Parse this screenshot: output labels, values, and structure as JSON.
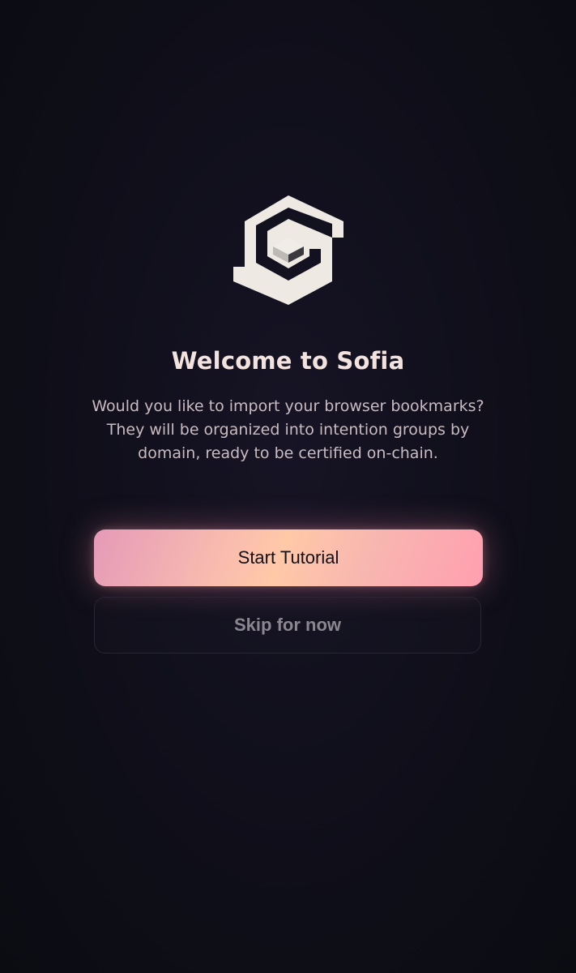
{
  "logo": {
    "icon": "sofia-hexagon-logo-icon"
  },
  "welcome": {
    "title": "Welcome to Sofia",
    "description": "Would you like to import your browser bookmarks? They will be organized into intention groups by domain, ready to be certified on-chain."
  },
  "actions": {
    "primary_label": "Start Tutorial",
    "secondary_label": "Skip for now"
  },
  "colors": {
    "background": "#0f0e1a",
    "title": "#f3e3df",
    "primary_gradient_start": "#e59ab8",
    "primary_gradient_mid": "#ffc9a8",
    "primary_gradient_end": "#ff9fb0",
    "logo": "#efe9e4"
  }
}
